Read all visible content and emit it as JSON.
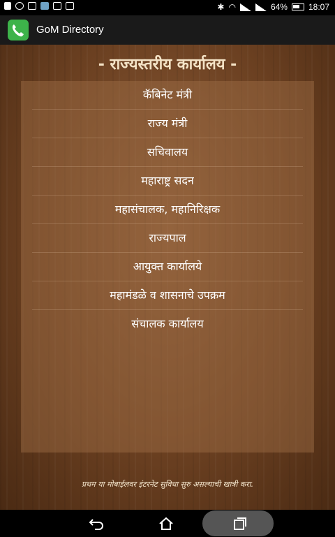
{
  "status_bar": {
    "battery": "64%",
    "time": "18:07"
  },
  "app": {
    "title": "GoM Directory"
  },
  "heading": "- राज्यस्तरीय कार्यालय -",
  "menu_items": [
    "कॅबिनेट मंत्री",
    "राज्य मंत्री",
    "सचिवालय",
    "महाराष्ट्र सदन",
    "महासंचालक, महानिरिक्षक",
    "राज्यपाल",
    "आयुक्त कार्यालये",
    "महामंडळे व शासनाचे उपक्रम",
    "संचालक कार्यालय"
  ],
  "footer_note": "प्रथम या मोबाईलवर इंटरनेट सुविधा सुरु असल्याची खात्री करा.",
  "colors": {
    "app_icon": "#3db34a",
    "heading": "#f4e3c6"
  }
}
